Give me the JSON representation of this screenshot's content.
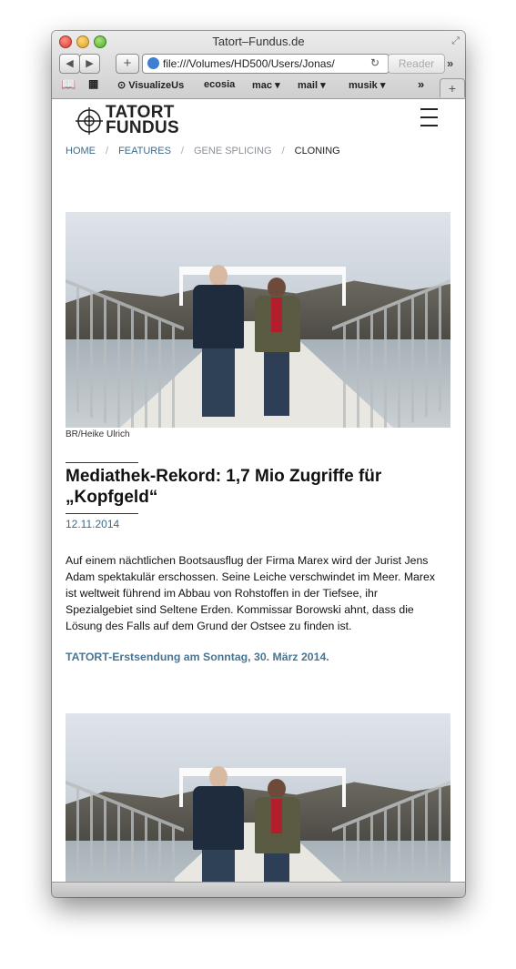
{
  "window": {
    "title": "Tatort–Fundus.de",
    "url": "file:///Volumes/HD500/Users/Jonas/",
    "reader_label": "Reader",
    "bookmarks": [
      "VisualizeUs",
      "ecosia",
      "mac ▾",
      "mail ▾",
      "musik ▾"
    ]
  },
  "site": {
    "logo": {
      "line1": "TATORT",
      "line2": "FUNDUS"
    },
    "breadcrumb": [
      "HOME",
      "FEATURES",
      "GENE SPLICING",
      "CLONING"
    ]
  },
  "article": {
    "image_caption": "BR/Heike Ulrich",
    "headline": "Mediathek-Rekord: 1,7 Mio Zugriffe für „Kopfgeld“",
    "date": "12.11.2014",
    "body": "Auf einem nächtlichen Bootsausflug der Firma Marex wird der Jurist Jens Adam spektakulär erschossen. Seine Leiche verschwindet im Meer. Marex ist weltweit führend im Abbau von Rohstoffen in der Tiefsee, ihr Spezialgebiet sind Seltene Erden. Kommissar Borowski ahnt, dass die Lösung des Falls auf dem Grund der Ostsee zu finden ist.",
    "cta": "TATORT-Erstsendung am Sonntag, 30. März 2014."
  },
  "icons": [
    "back-icon",
    "forward-icon",
    "add-icon",
    "globe-icon",
    "reload-icon",
    "book-icon",
    "grid-icon",
    "menu-icon",
    "crosshair-logo-icon"
  ],
  "colors": {
    "link": "#3e6a88",
    "cta": "#4a7592",
    "text": "#111111"
  }
}
